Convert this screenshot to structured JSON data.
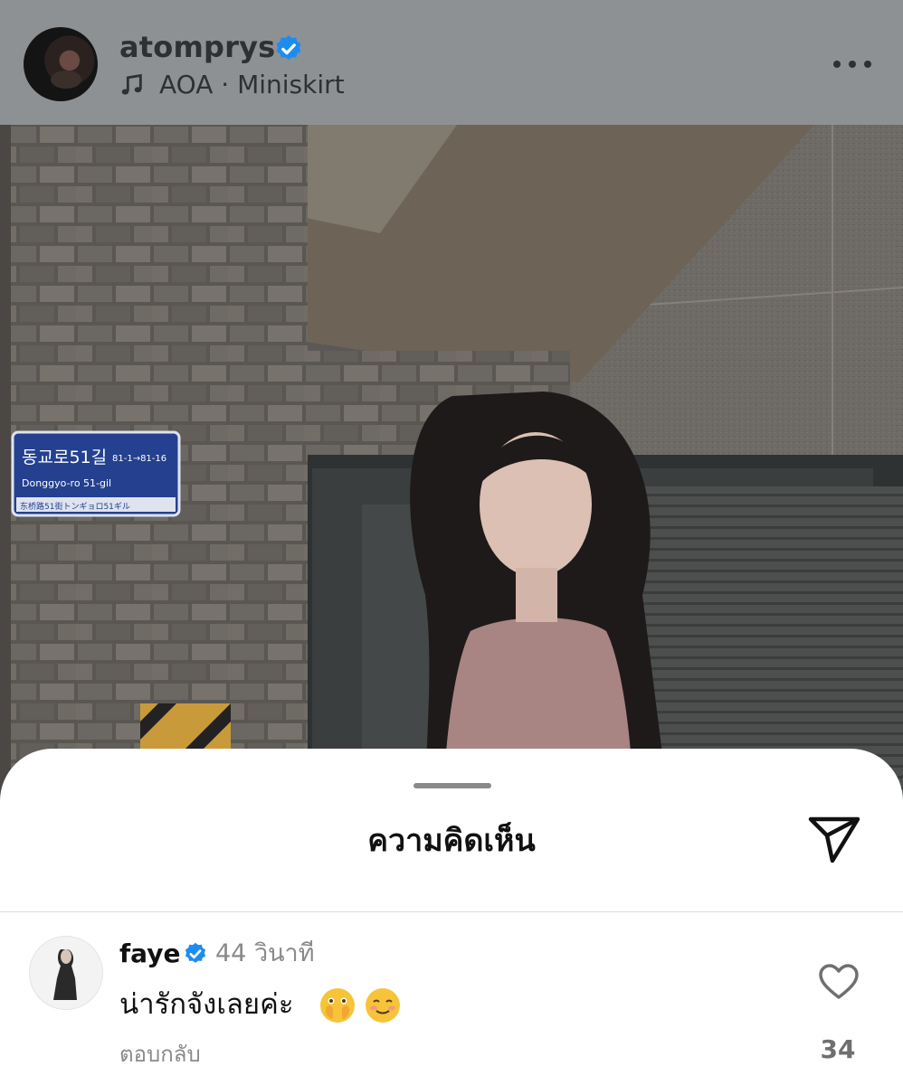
{
  "post": {
    "username": "atomprys",
    "verified": true,
    "music": "AOA · Miniskirt",
    "more_icon": "more-horizontal-icon",
    "photo": {
      "street_sign_korean": "동교로51길",
      "street_sign_range": "81-1→81-16",
      "street_sign_roman": "Donggyo-ro 51-gil",
      "street_sign_small": "东桥路51街トンギョロ51ギル"
    }
  },
  "comments_sheet": {
    "title": "ความคิดเห็น",
    "share_icon": "send-icon",
    "comments": [
      {
        "username": "faye",
        "verified": true,
        "time": "44 วินาที",
        "text": "น่ารักจังเลยค่ะ",
        "emojis": [
          "face-with-open-eyes-and-hand-over-mouth",
          "smiling-face"
        ],
        "reply_label": "ตอบกลับ",
        "like_count": "34"
      }
    ]
  },
  "colors": {
    "header_overlay": "#8e9194",
    "verified_blue": "#1d8cf0",
    "text_primary": "#111111",
    "text_secondary": "#8a8a8a"
  }
}
